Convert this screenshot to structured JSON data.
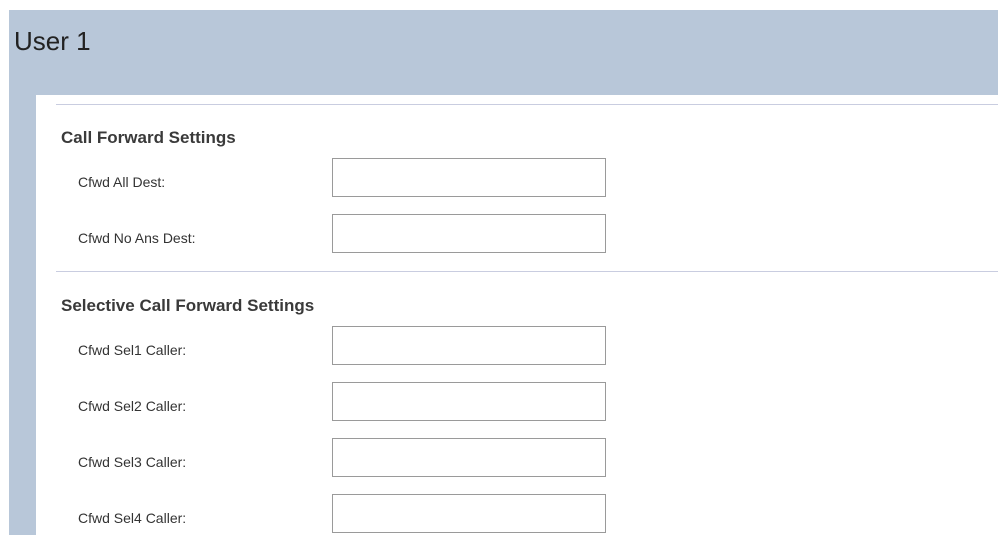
{
  "header": {
    "title": "User 1"
  },
  "call_forward": {
    "title": "Call Forward Settings",
    "fields": [
      {
        "label": "Cfwd All Dest:",
        "value": ""
      },
      {
        "label": "Cfwd No Ans Dest:",
        "value": ""
      }
    ]
  },
  "selective_call_forward": {
    "title": "Selective Call Forward Settings",
    "fields": [
      {
        "label": "Cfwd Sel1 Caller:",
        "value": ""
      },
      {
        "label": "Cfwd Sel2 Caller:",
        "value": ""
      },
      {
        "label": "Cfwd Sel3 Caller:",
        "value": ""
      },
      {
        "label": "Cfwd Sel4 Caller:",
        "value": ""
      }
    ]
  },
  "colors": {
    "header_background": "#b8c7d9",
    "panel_background": "#ffffff",
    "divider": "#c9cde0",
    "input_border": "#9a9a9a"
  }
}
